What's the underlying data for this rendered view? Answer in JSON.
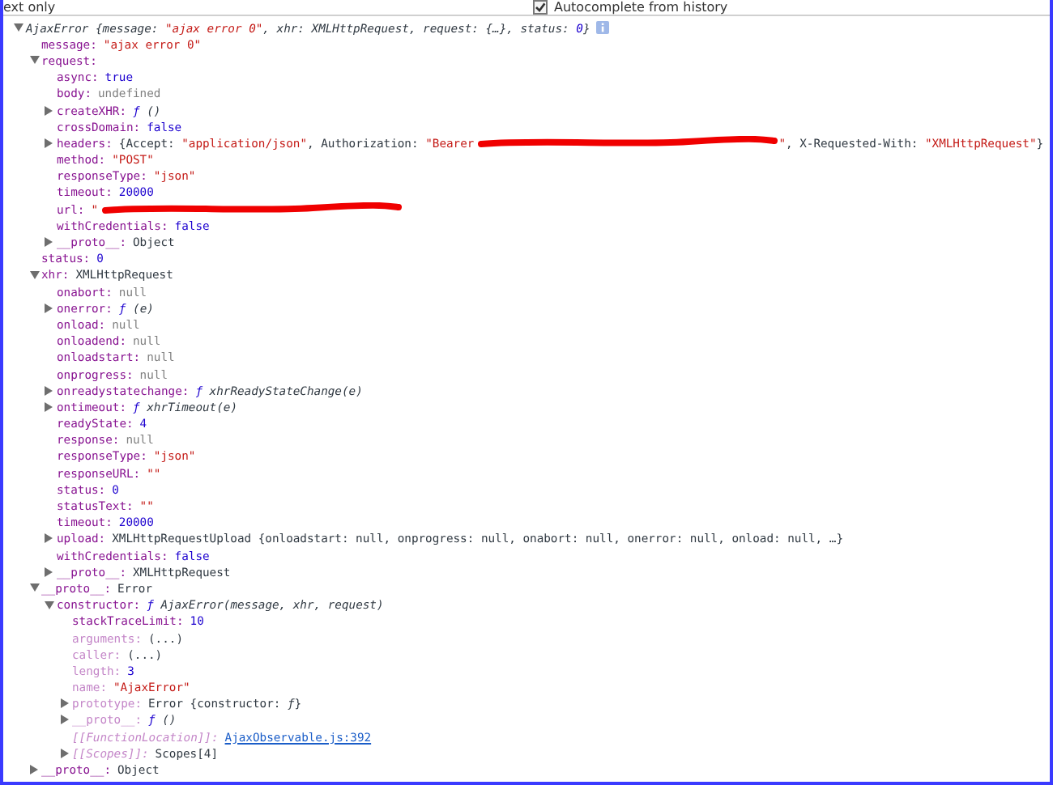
{
  "toolbar": {
    "cut_label": "ext only",
    "autocomplete": {
      "label": "Autocomplete from history",
      "checked": true
    }
  },
  "tree": [
    {
      "italic": true,
      "expanded": true,
      "info_icon": true,
      "value": [
        {
          "kind": "plain",
          "text": "AjaxError {message: "
        },
        {
          "kind": "str",
          "text": "\"ajax error 0\""
        },
        {
          "kind": "plain",
          "text": ", xhr: XMLHttpRequest, request: {…}, status: "
        },
        {
          "kind": "num",
          "text": "0"
        },
        {
          "kind": "plain",
          "text": "}"
        }
      ],
      "children": [
        {
          "key": "message:",
          "value": [
            {
              "kind": "str",
              "text": "\"ajax error 0\""
            }
          ]
        },
        {
          "key": "request:",
          "expanded": true,
          "children": [
            {
              "key": "async:",
              "value": [
                {
                  "kind": "num",
                  "text": "true"
                }
              ]
            },
            {
              "key": "body:",
              "value": [
                {
                  "kind": "nul",
                  "text": "undefined"
                }
              ]
            },
            {
              "key": "createXHR:",
              "expanded": false,
              "value": [
                {
                  "kind": "fsym",
                  "text": "ƒ"
                },
                {
                  "kind": "fn",
                  "text": " ()"
                }
              ]
            },
            {
              "key": "crossDomain:",
              "value": [
                {
                  "kind": "num",
                  "text": "false"
                }
              ]
            },
            {
              "key": "headers:",
              "expanded": false,
              "value": [
                {
                  "kind": "plain",
                  "text": "{Accept: "
                },
                {
                  "kind": "str",
                  "text": "\"application/json\""
                },
                {
                  "kind": "plain",
                  "text": ", Authorization: "
                },
                {
                  "kind": "str",
                  "text": "\"Bearer"
                },
                {
                  "kind": "redaction"
                },
                {
                  "kind": "str",
                  "text": "\""
                },
                {
                  "kind": "plain",
                  "text": ", X-Requested-With: "
                },
                {
                  "kind": "str",
                  "text": "\"XMLHttpRequest\""
                },
                {
                  "kind": "plain",
                  "text": "}"
                }
              ]
            },
            {
              "key": "method:",
              "value": [
                {
                  "kind": "str",
                  "text": "\"POST\""
                }
              ]
            },
            {
              "key": "responseType:",
              "value": [
                {
                  "kind": "str",
                  "text": "\"json\""
                }
              ]
            },
            {
              "key": "timeout:",
              "value": [
                {
                  "kind": "num",
                  "text": "20000"
                }
              ]
            },
            {
              "key": "url:",
              "value": [
                {
                  "kind": "str",
                  "text": "\""
                },
                {
                  "kind": "redaction"
                }
              ]
            },
            {
              "key": "withCredentials:",
              "value": [
                {
                  "kind": "num",
                  "text": "false"
                }
              ]
            },
            {
              "key": "__proto__:",
              "expanded": false,
              "value": [
                {
                  "kind": "plain",
                  "text": "Object"
                }
              ]
            }
          ]
        },
        {
          "key": "status:",
          "value": [
            {
              "kind": "num",
              "text": "0"
            }
          ]
        },
        {
          "key": "xhr:",
          "expanded": true,
          "value": [
            {
              "kind": "plain",
              "text": "XMLHttpRequest"
            }
          ],
          "children": [
            {
              "key": "onabort:",
              "value": [
                {
                  "kind": "nul",
                  "text": "null"
                }
              ]
            },
            {
              "key": "onerror:",
              "expanded": false,
              "value": [
                {
                  "kind": "fsym",
                  "text": "ƒ"
                },
                {
                  "kind": "fn",
                  "text": " (e)"
                }
              ]
            },
            {
              "key": "onload:",
              "value": [
                {
                  "kind": "nul",
                  "text": "null"
                }
              ]
            },
            {
              "key": "onloadend:",
              "value": [
                {
                  "kind": "nul",
                  "text": "null"
                }
              ]
            },
            {
              "key": "onloadstart:",
              "value": [
                {
                  "kind": "nul",
                  "text": "null"
                }
              ]
            },
            {
              "key": "onprogress:",
              "value": [
                {
                  "kind": "nul",
                  "text": "null"
                }
              ]
            },
            {
              "key": "onreadystatechange:",
              "expanded": false,
              "value": [
                {
                  "kind": "fsym",
                  "text": "ƒ"
                },
                {
                  "kind": "fn",
                  "text": " xhrReadyStateChange(e)"
                }
              ]
            },
            {
              "key": "ontimeout:",
              "expanded": false,
              "value": [
                {
                  "kind": "fsym",
                  "text": "ƒ"
                },
                {
                  "kind": "fn",
                  "text": " xhrTimeout(e)"
                }
              ]
            },
            {
              "key": "readyState:",
              "value": [
                {
                  "kind": "num",
                  "text": "4"
                }
              ]
            },
            {
              "key": "response:",
              "value": [
                {
                  "kind": "nul",
                  "text": "null"
                }
              ]
            },
            {
              "key": "responseType:",
              "value": [
                {
                  "kind": "str",
                  "text": "\"json\""
                }
              ]
            },
            {
              "key": "responseURL:",
              "value": [
                {
                  "kind": "str",
                  "text": "\"\""
                }
              ]
            },
            {
              "key": "status:",
              "value": [
                {
                  "kind": "num",
                  "text": "0"
                }
              ]
            },
            {
              "key": "statusText:",
              "value": [
                {
                  "kind": "str",
                  "text": "\"\""
                }
              ]
            },
            {
              "key": "timeout:",
              "value": [
                {
                  "kind": "num",
                  "text": "20000"
                }
              ]
            },
            {
              "key": "upload:",
              "expanded": false,
              "value": [
                {
                  "kind": "plain",
                  "text": "XMLHttpRequestUpload {onloadstart: null, onprogress: null, onabort: null, onerror: null, onload: null, …}"
                }
              ]
            },
            {
              "key": "withCredentials:",
              "value": [
                {
                  "kind": "num",
                  "text": "false"
                }
              ]
            },
            {
              "key": "__proto__:",
              "expanded": false,
              "value": [
                {
                  "kind": "plain",
                  "text": "XMLHttpRequest"
                }
              ]
            }
          ]
        },
        {
          "key": "__proto__:",
          "expanded": true,
          "value": [
            {
              "kind": "plain",
              "text": "Error"
            }
          ],
          "children": [
            {
              "key": "constructor:",
              "expanded": true,
              "value": [
                {
                  "kind": "fsym",
                  "text": "ƒ"
                },
                {
                  "kind": "fn",
                  "text": " AjaxError(message, xhr, request)"
                }
              ],
              "children": [
                {
                  "key": "stackTraceLimit:",
                  "value": [
                    {
                      "kind": "num",
                      "text": "10"
                    }
                  ]
                },
                {
                  "key": "arguments:",
                  "dim": true,
                  "value": [
                    {
                      "kind": "plain",
                      "text": "(...)"
                    }
                  ]
                },
                {
                  "key": "caller:",
                  "dim": true,
                  "value": [
                    {
                      "kind": "plain",
                      "text": "(...)"
                    }
                  ]
                },
                {
                  "key": "length:",
                  "dim": true,
                  "value": [
                    {
                      "kind": "num",
                      "text": "3"
                    }
                  ]
                },
                {
                  "key": "name:",
                  "dim": true,
                  "value": [
                    {
                      "kind": "str",
                      "text": "\"AjaxError\""
                    }
                  ]
                },
                {
                  "key": "prototype:",
                  "dim": true,
                  "expanded": false,
                  "value": [
                    {
                      "kind": "plain",
                      "text": "Error {constructor: "
                    },
                    {
                      "kind": "fn",
                      "text": "ƒ"
                    },
                    {
                      "kind": "plain",
                      "text": "}"
                    }
                  ]
                },
                {
                  "key": "__proto__:",
                  "dim": true,
                  "expanded": false,
                  "value": [
                    {
                      "kind": "fsym",
                      "text": "ƒ"
                    },
                    {
                      "kind": "fn",
                      "text": " ()"
                    }
                  ]
                },
                {
                  "key": "[[FunctionLocation]]:",
                  "dim": true,
                  "italic_key": true,
                  "value": [
                    {
                      "kind": "link",
                      "text": "AjaxObservable.js:392"
                    }
                  ]
                },
                {
                  "key": "[[Scopes]]:",
                  "dim": true,
                  "italic_key": true,
                  "expanded": false,
                  "value": [
                    {
                      "kind": "plain",
                      "text": "Scopes[4]"
                    }
                  ]
                }
              ]
            }
          ]
        },
        {
          "key": "__proto__:",
          "expanded": false,
          "value": [
            {
              "kind": "plain",
              "text": "Object"
            }
          ]
        }
      ]
    }
  ]
}
